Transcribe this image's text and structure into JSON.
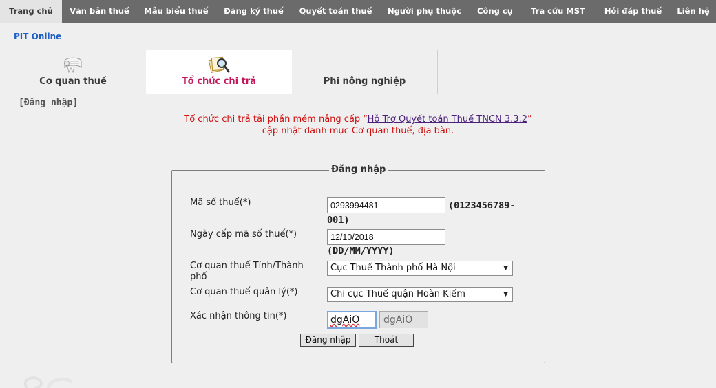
{
  "nav": {
    "items": [
      "Trang chủ",
      "Văn bản thuế",
      "Mẫu biểu thuế",
      "Đăng ký thuế",
      "Quyết toán thuế",
      "Người phụ thuộc",
      "Công cụ",
      "Tra cứu MST",
      "Hỏi đáp thuế",
      "Liên hệ"
    ],
    "active_index": 0
  },
  "brand": "PIT Online",
  "tabs": [
    {
      "label": "Cơ quan thuế",
      "icon": "certificate-scroll-icon"
    },
    {
      "label": "Tổ chức chi trả",
      "icon": "magnifier-documents-icon"
    },
    {
      "label": "Phi nông nghiệp",
      "icon": ""
    }
  ],
  "active_tab": 1,
  "breadcrumb": "[Đăng nhập]",
  "notice": {
    "prefix": "Tổ chức chi trả tải phần mềm nâng cấp “",
    "link": "Hỗ Trợ Quyết toán Thuế TNCN 3.3.2",
    "suffix": "”",
    "line2": "cập nhật danh mục Cơ quan thuế, địa bàn."
  },
  "login": {
    "legend": "Đăng nhập",
    "tax_code_label": "Mã số thuế(*)",
    "tax_code_value": "0293994481",
    "tax_code_hint": "(0123456789-001)",
    "date_label": "Ngày cấp mã số thuế(*)",
    "date_value": "12/10/2018",
    "date_hint": "(DD/MM/YYYY)",
    "province_label": "Cơ quan thuế Tỉnh/Thành phố",
    "province_value": "Cục Thuế Thành phố Hà Nội",
    "office_label": "Cơ quan thuế quản lý(*)",
    "office_value": "Chi cục Thuế quận Hoàn Kiếm",
    "captcha_label": "Xác nhận thông tin(*)",
    "captcha_input": "dgAiO",
    "captcha_image": "dgAiO",
    "login_button": "Đăng nhập",
    "exit_button": "Thoát"
  }
}
